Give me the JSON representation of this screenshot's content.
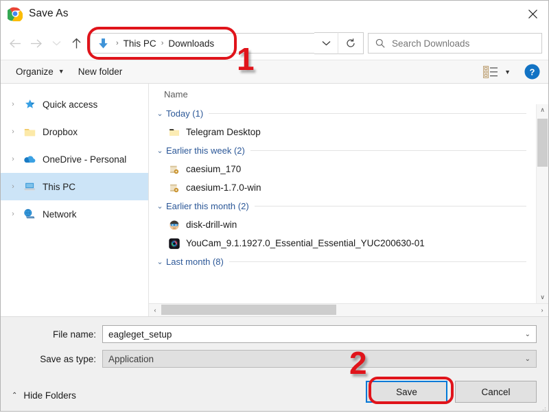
{
  "window": {
    "title": "Save As",
    "app_icon": "chrome-logo-icon",
    "close_label": "✕"
  },
  "nav": {
    "back_icon": "back-arrow-icon",
    "forward_icon": "forward-arrow-icon",
    "recent_icon": "chevron-down-icon",
    "up_icon": "up-arrow-icon",
    "breadcrumb": {
      "location_icon": "downloads-arrow-icon",
      "items": [
        "This PC",
        "Downloads"
      ],
      "separator": "›"
    },
    "breadcrumb_dropdown_icon": "chevron-down-icon",
    "refresh_icon": "refresh-icon"
  },
  "search": {
    "icon": "search-icon",
    "placeholder": "Search Downloads",
    "value": ""
  },
  "toolbar": {
    "organize_label": "Organize",
    "organize_caret": "▼",
    "new_folder_label": "New folder",
    "view_icon": "view-details-icon",
    "view_caret": "▼",
    "help_icon": "help-icon",
    "help_label": "?"
  },
  "sidebar": {
    "items": [
      {
        "label": "Quick access",
        "icon": "star-icon",
        "expand": "›",
        "selected": false
      },
      {
        "label": "Dropbox",
        "icon": "folder-icon",
        "expand": "›",
        "selected": false
      },
      {
        "label": "OneDrive - Personal",
        "icon": "cloud-icon",
        "expand": "›",
        "selected": false
      },
      {
        "label": "This PC",
        "icon": "computer-icon",
        "expand": "›",
        "selected": true
      },
      {
        "label": "Network",
        "icon": "network-icon",
        "expand": "›",
        "selected": false
      }
    ]
  },
  "file_list": {
    "column_header": "Name",
    "groups": [
      {
        "label": "Today (1)",
        "chevron": "⌄",
        "files": [
          {
            "name": "Telegram Desktop",
            "icon": "folder-icon"
          }
        ]
      },
      {
        "label": "Earlier this week (2)",
        "chevron": "⌄",
        "files": [
          {
            "name": "caesium_170",
            "icon": "installer-icon"
          },
          {
            "name": "caesium-1.7.0-win",
            "icon": "installer-icon"
          }
        ]
      },
      {
        "label": "Earlier this month (2)",
        "chevron": "⌄",
        "files": [
          {
            "name": "disk-drill-win",
            "icon": "disk-drill-icon"
          },
          {
            "name": "YouCam_9.1.1927.0_Essential_Essential_YUC200630-01",
            "icon": "youcam-icon"
          }
        ]
      },
      {
        "label": "Last month (8)",
        "chevron": "⌄",
        "files": []
      }
    ],
    "vertical_scrollbar": {
      "up": "∧",
      "down": "∨"
    },
    "horizontal_scrollbar": {
      "left": "‹",
      "right": "›"
    }
  },
  "footer": {
    "file_name_label": "File name:",
    "file_name_value": "eagleget_setup",
    "file_name_caret": "⌄",
    "save_as_type_label": "Save as type:",
    "save_as_type_value": "Application",
    "save_as_type_caret": "⌄",
    "hide_folders_label": "Hide Folders",
    "hide_folders_caret": "⌃",
    "save_label": "Save",
    "cancel_label": "Cancel"
  },
  "annotations": {
    "color": "#e0141b",
    "marker_one": "1",
    "marker_two": "2"
  }
}
